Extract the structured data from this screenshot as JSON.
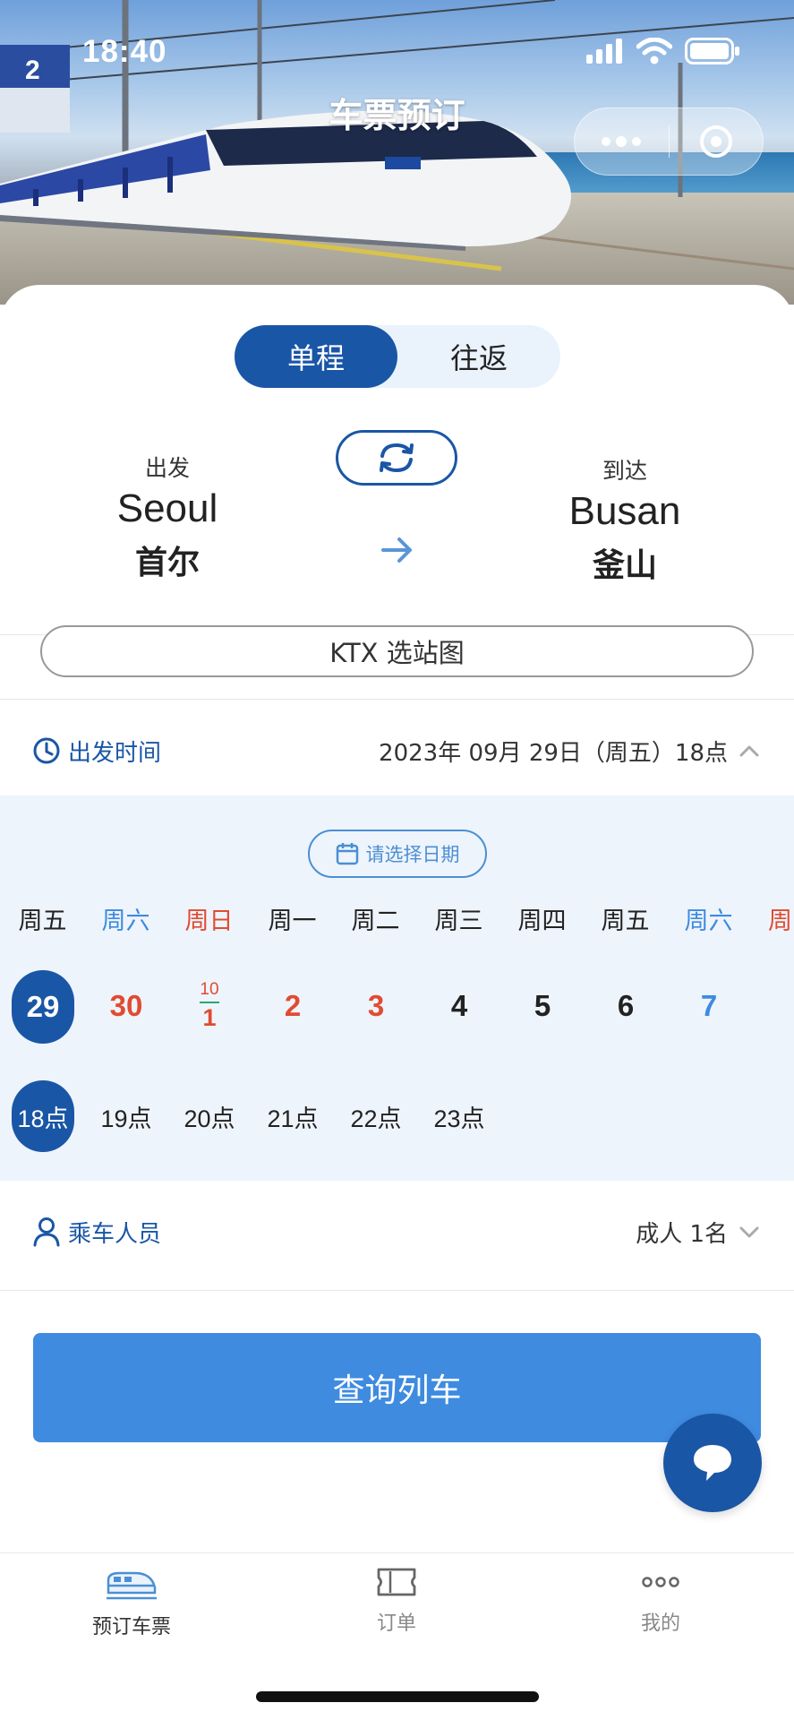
{
  "status_bar": {
    "time": "18:40"
  },
  "nav": {
    "title": "车票预订"
  },
  "trip_type": {
    "options": [
      "单程",
      "往返"
    ],
    "selected": "单程"
  },
  "departure": {
    "label": "出发",
    "name_en": "Seoul",
    "name_cn": "首尔"
  },
  "arrival": {
    "label": "到达",
    "name_en": "Busan",
    "name_cn": "釜山"
  },
  "station_map_button": "KTX 选站图",
  "departure_time": {
    "label": "出发时间",
    "value": "2023年 09月 29日（周五）18点"
  },
  "calendar": {
    "pick_date_label": "请选择日期",
    "weekdays": [
      "周五",
      "周六",
      "周日",
      "周一",
      "周二",
      "周三",
      "周四",
      "周五",
      "周六",
      "周"
    ],
    "dates": [
      "29",
      "30",
      "1",
      "2",
      "3",
      "4",
      "5",
      "6",
      "7"
    ],
    "month_marker": "10",
    "selected_date": "29",
    "hours": [
      "18点",
      "19点",
      "20点",
      "21点",
      "22点",
      "23点"
    ],
    "selected_hour": "18点",
    "colors": {
      "saturday": "#3d8be0",
      "holiday": "#e04b32",
      "selected": "#1a56a6"
    }
  },
  "passengers": {
    "label": "乘车人员",
    "value": "成人 1名"
  },
  "search_button": "查询列车",
  "tabbar": {
    "items": [
      {
        "label": "预订车票",
        "icon": "train-icon",
        "active": true
      },
      {
        "label": "订单",
        "icon": "ticket-icon",
        "active": false
      },
      {
        "label": "我的",
        "icon": "more-dots-icon",
        "active": false
      }
    ]
  },
  "colors": {
    "primary": "#1a56a6",
    "accent": "#3e8be0",
    "background_panel": "#eef4fb"
  }
}
